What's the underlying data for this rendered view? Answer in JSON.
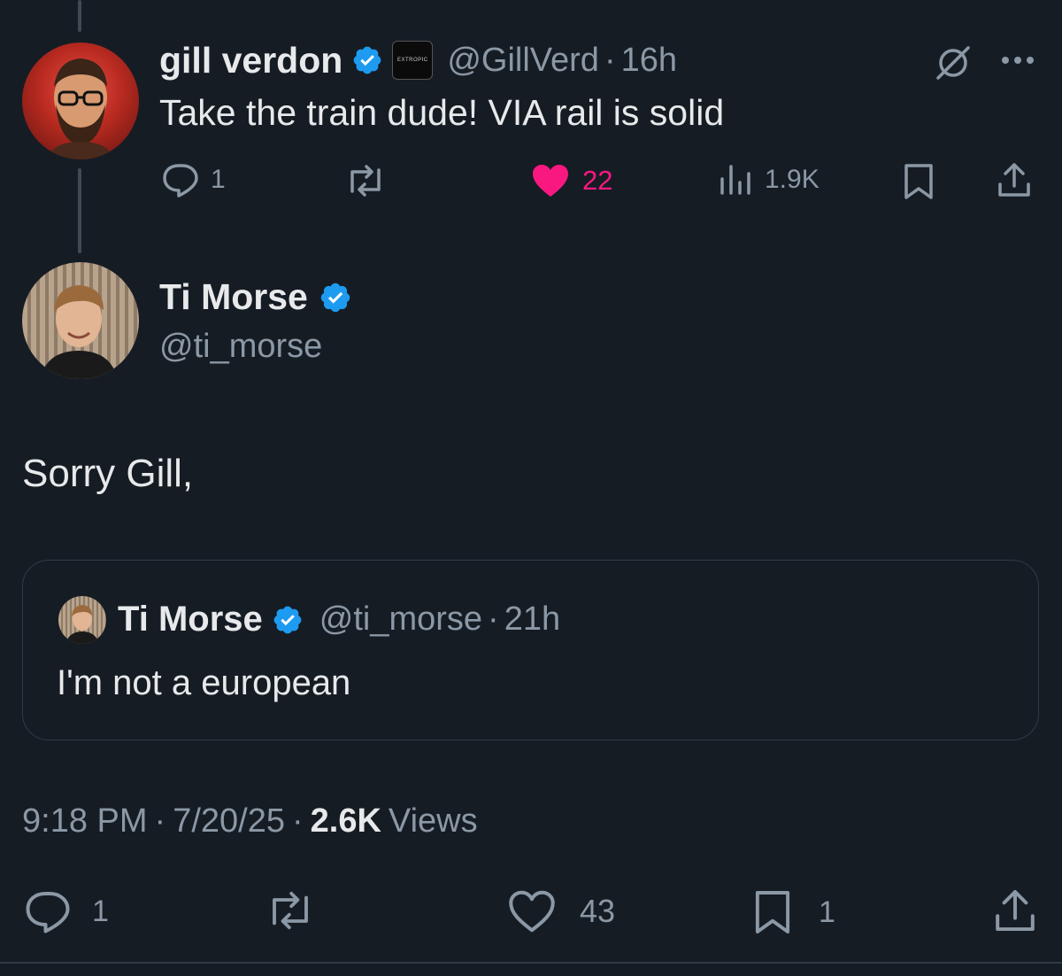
{
  "reply_parent": {
    "author_name": "gill verdon",
    "handle": "@GillVerd",
    "separator": "·",
    "time": "16h",
    "badge_text": "EXTROPIC",
    "text": "Take the train dude! VIA rail is solid",
    "stats": {
      "replies": "1",
      "likes": "22",
      "views": "1.9K"
    },
    "colors": {
      "like_active": "#f91880",
      "verified": "#1d9bf0"
    }
  },
  "main_tweet": {
    "author_name": "Ti Morse",
    "handle": "@ti_morse",
    "text": "Sorry Gill,",
    "quote": {
      "author_name": "Ti Morse",
      "handle": "@ti_morse",
      "separator": "·",
      "time": "21h",
      "text": "I'm not a european"
    },
    "meta": {
      "time": "9:18 PM",
      "sep1": "·",
      "date": "7/20/25",
      "sep2": "·",
      "views_count": "2.6K",
      "views_label": "Views"
    },
    "actions": {
      "replies": "1",
      "likes": "43",
      "bookmarks": "1"
    }
  },
  "icons": [
    "reply-icon",
    "retweet-icon",
    "like-icon",
    "views-icon",
    "bookmark-icon",
    "share-icon",
    "grok-icon",
    "more-icon",
    "verified-icon"
  ]
}
